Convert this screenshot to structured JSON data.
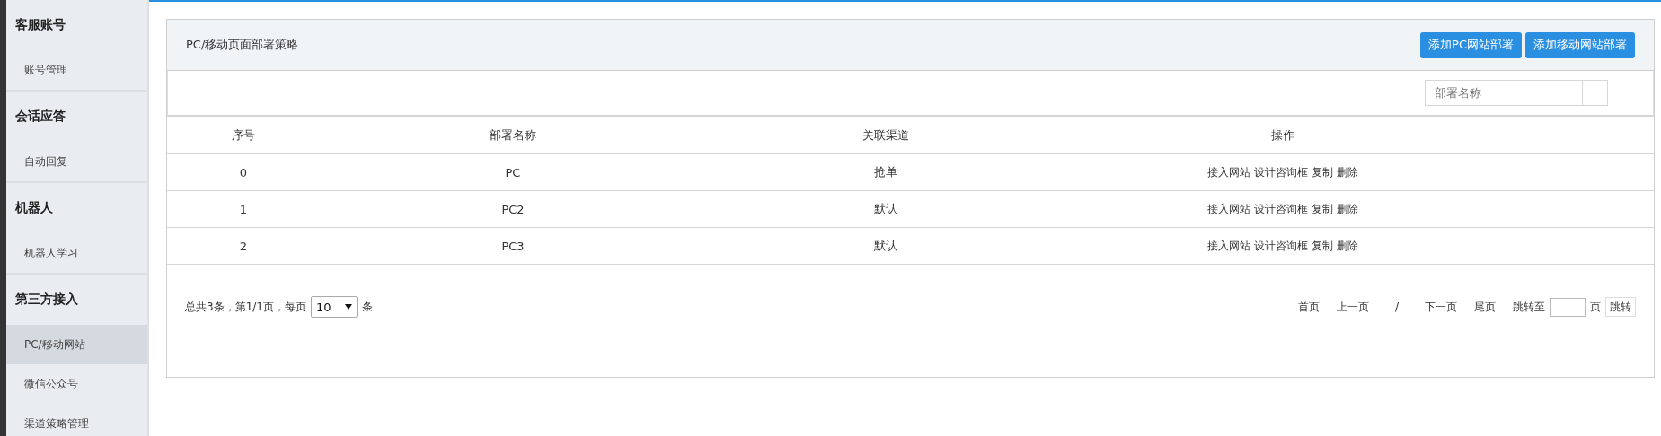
{
  "sidebar": {
    "groups": [
      {
        "title": "客服账号",
        "items": [
          {
            "label": "账号管理",
            "selected": false
          }
        ]
      },
      {
        "title": "会话应答",
        "items": [
          {
            "label": "自动回复",
            "selected": false
          }
        ]
      },
      {
        "title": "机器人",
        "items": [
          {
            "label": "机器人学习",
            "selected": false
          }
        ]
      },
      {
        "title": "第三方接入",
        "items": [
          {
            "label": "PC/移动网站",
            "selected": true
          },
          {
            "label": "微信公众号",
            "selected": false
          },
          {
            "label": "渠道策略管理",
            "selected": false
          }
        ]
      }
    ]
  },
  "panel": {
    "title": "PC/移动页面部署策略",
    "buttons": [
      "添加PC网站部署",
      "添加移动网站部署"
    ],
    "search": {
      "placeholder": "部署名称"
    },
    "table": {
      "columns": [
        "序号",
        "部署名称",
        "关联渠道",
        "操作"
      ],
      "rows": [
        {
          "cells": [
            "0",
            "PC",
            "抢单"
          ],
          "actions": [
            "接入网站",
            "设计咨询框",
            "复制",
            "删除"
          ]
        },
        {
          "cells": [
            "1",
            "PC2",
            "默认"
          ],
          "actions": [
            "接入网站",
            "设计咨询框",
            "复制",
            "删除"
          ]
        },
        {
          "cells": [
            "2",
            "PC3",
            "默认"
          ],
          "actions": [
            "接入网站",
            "设计咨询框",
            "复制",
            "删除"
          ]
        }
      ]
    },
    "pagination": {
      "summary": "总共3条，第1/1页，每页",
      "page_size": "10",
      "unit": "条",
      "items": [
        {
          "kind": "link",
          "text": "首页"
        },
        {
          "kind": "link",
          "text": "上一页"
        },
        {
          "kind": "separator",
          "text": "/"
        },
        {
          "kind": "link",
          "text": "下一页"
        },
        {
          "kind": "link",
          "text": "尾页"
        }
      ],
      "jump_label": "跳转至",
      "jump_unit": "页",
      "jump_button": "跳转"
    }
  }
}
